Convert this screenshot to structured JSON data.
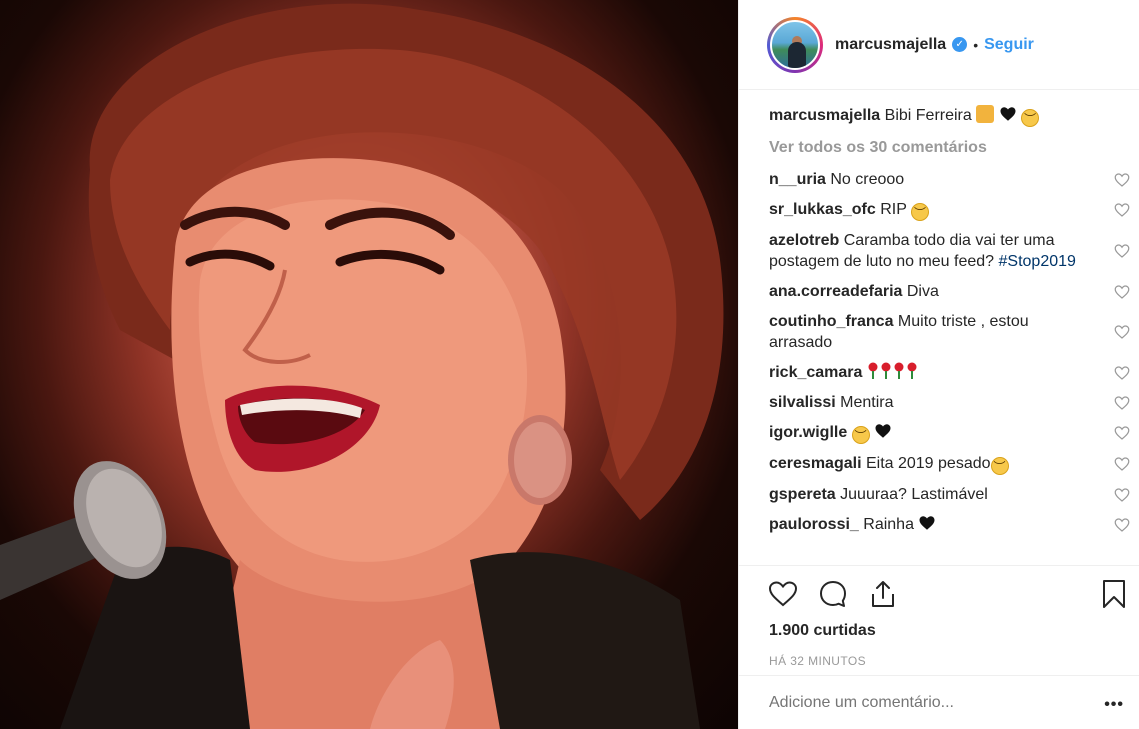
{
  "header": {
    "username": "marcusmajella",
    "separator": "•",
    "follow_label": "Seguir"
  },
  "caption": {
    "username": "marcusmajella",
    "text": "Bibi Ferreira",
    "emoji_icons": [
      "theater-masks-icon",
      "black-heart-icon",
      "sad-face-icon"
    ]
  },
  "view_all": "Ver todos os 30 comentários",
  "comments": [
    {
      "user": "n__uria",
      "text": "No creooo"
    },
    {
      "user": "sr_lukkas_ofc",
      "text": "RIP",
      "emoji": "sad-face-icon"
    },
    {
      "user": "azelotreb",
      "text": "Caramba todo dia vai ter uma postagem de luto no meu feed?",
      "tag": "#Stop2019"
    },
    {
      "user": "ana.correadefaria",
      "text": "Diva"
    },
    {
      "user": "coutinho_franca",
      "text": "Muito triste , estou arrasado"
    },
    {
      "user": "rick_camara",
      "text": "",
      "emoji": "rose-icon x4"
    },
    {
      "user": "silvalissi",
      "text": "Mentira"
    },
    {
      "user": "igor.wiglle",
      "text": "",
      "emoji": "sad-face-icon, black-heart-icon"
    },
    {
      "user": "ceresmagali",
      "text": "Eita 2019 pesado",
      "emoji": "sad-face-icon"
    },
    {
      "user": "gspereta",
      "text": "Juuuraa? Lastimável"
    },
    {
      "user": "paulorossi_",
      "text": "Rainha",
      "emoji": "black-heart-icon"
    }
  ],
  "likes": "1.900 curtidas",
  "time": "HÁ 32 MINUTOS",
  "add_comment": {
    "placeholder": "Adicione um comentário..."
  },
  "more": "•••",
  "colors": {
    "link": "#3897f0",
    "muted": "#999999",
    "text": "#262626",
    "border": "#efefef"
  }
}
